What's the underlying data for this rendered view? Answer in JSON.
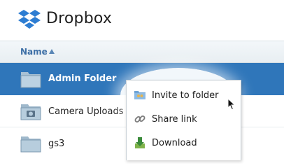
{
  "header": {
    "brand": "Dropbox"
  },
  "table": {
    "column_name": "Name",
    "sort": "ascending"
  },
  "files": [
    {
      "name": "Admin Folder",
      "icon": "shared-folder-icon",
      "selected": true
    },
    {
      "name": "Camera Uploads",
      "icon": "camera-folder-icon",
      "selected": false
    },
    {
      "name": "gs3",
      "icon": "folder-icon",
      "selected": false
    }
  ],
  "context_menu": {
    "items": [
      {
        "label": "Invite to folder",
        "icon": "share-folder-icon"
      },
      {
        "label": "Share link",
        "icon": "link-icon"
      },
      {
        "label": "Download",
        "icon": "download-icon"
      }
    ]
  },
  "colors": {
    "selected_row": "#2f76ba",
    "header_text": "#3d6fa6",
    "brand_blue": "#2d7dd2"
  }
}
